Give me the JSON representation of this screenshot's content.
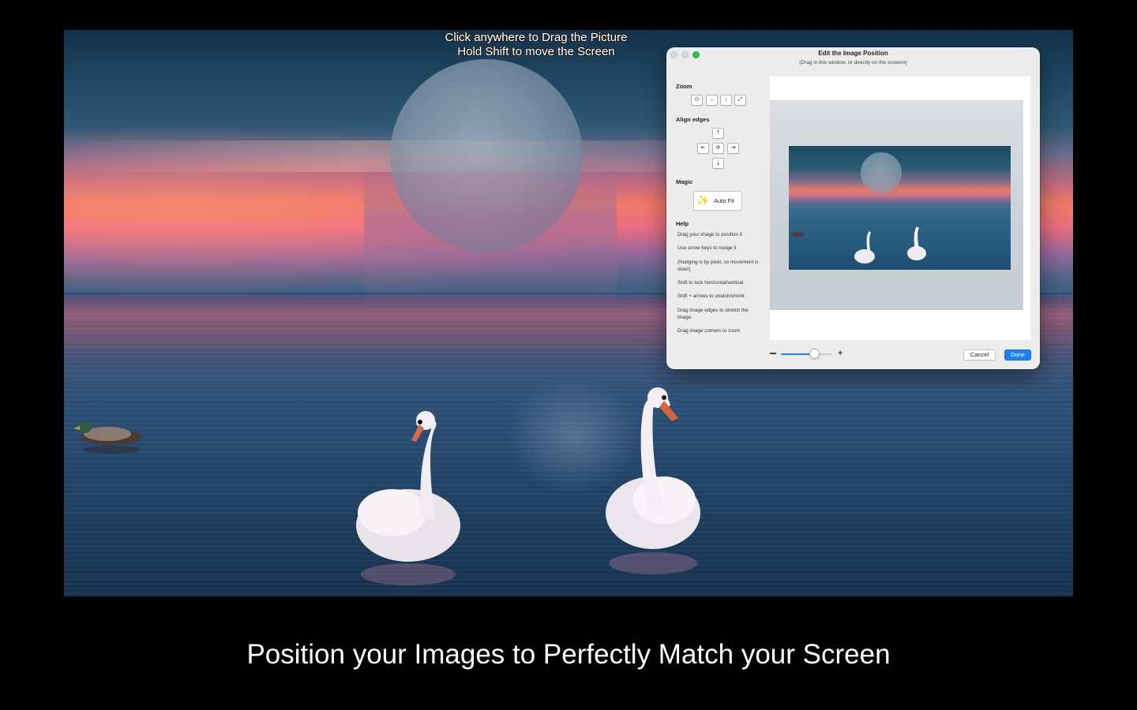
{
  "overlay_hint": {
    "line1": "Click anywhere to Drag the Picture",
    "line2": "Hold Shift to move the Screen"
  },
  "dialog": {
    "title": "Edit the Image Position",
    "subtitle": "(Drag in this window, or directly on the screens)",
    "zoom": {
      "heading": "Zoom",
      "buttons": [
        {
          "icon": "zoom-fit-icon",
          "glyph": "⊙"
        },
        {
          "icon": "fit-width-icon",
          "glyph": "↔"
        },
        {
          "icon": "fit-height-icon",
          "glyph": "↕"
        },
        {
          "icon": "fill-diagonal-icon",
          "glyph": "⤢"
        }
      ]
    },
    "align": {
      "heading": "Align edges",
      "top_glyph": "⤒",
      "left_glyph": "⇤",
      "center_glyph": "✣",
      "right_glyph": "⇥",
      "bottom_glyph": "⤓"
    },
    "magic": {
      "heading": "Magic",
      "auto_fit_label": "Auto Fit",
      "wand_glyph": "✨"
    },
    "help": {
      "heading": "Help",
      "items": [
        "Drag your image to position it",
        "Use arrow keys to nudge it",
        "(Nudging is by pixel, so movement is slow!)",
        "Shift to lock horizontal/vertical",
        "Shift + arrows to stretch/shrink",
        "Drag image edges to stretch the image.",
        "Drag image corners to zoom"
      ]
    },
    "zoom_slider": {
      "value": 0.65,
      "minus_glyph": "−",
      "plus_glyph": "+"
    },
    "cancel_label": "Cancel",
    "done_label": "Done",
    "accent_color": "#1f7ff5"
  },
  "caption": "Position your Images to Perfectly Match your Screen"
}
